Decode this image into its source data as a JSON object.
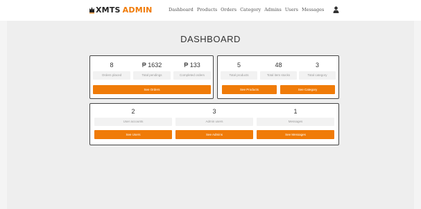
{
  "brand": {
    "word1": "XMTS",
    "word2": "ADMIN"
  },
  "nav": [
    "Dashboard",
    "Products",
    "Orders",
    "Category",
    "Admins",
    "Users",
    "Messages"
  ],
  "page_title": "DASHBOARD",
  "card1": {
    "stats": [
      {
        "value": "8",
        "label": "Orders placed"
      },
      {
        "value": "₱ 1632",
        "label": "Total pendings"
      },
      {
        "value": "₱ 133",
        "label": "Completed orders"
      }
    ],
    "button": "See Orders"
  },
  "card2": {
    "stats": [
      {
        "value": "5",
        "label": "Total products"
      },
      {
        "value": "48",
        "label": "Total item stocks"
      },
      {
        "value": "3",
        "label": "Total category"
      }
    ],
    "buttons": [
      "See Products",
      "See Category"
    ]
  },
  "card3": {
    "stats": [
      {
        "value": "2",
        "label": "User accounts"
      },
      {
        "value": "3",
        "label": "Admin users"
      },
      {
        "value": "1",
        "label": "Messages"
      }
    ],
    "buttons": [
      "See Users",
      "See Admins",
      "See Messages"
    ]
  },
  "colors": {
    "accent": "#f07b08",
    "background": "#f4f4f4"
  },
  "icons": {
    "brand": "crown-icon",
    "user": "user-icon"
  }
}
